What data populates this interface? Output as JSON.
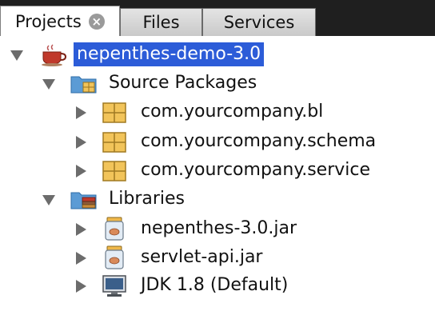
{
  "tabs": [
    {
      "label": "Projects",
      "active": true,
      "close_glyph": "×"
    },
    {
      "label": "Files",
      "active": false
    },
    {
      "label": "Services",
      "active": false
    }
  ],
  "tree": {
    "project": {
      "label": "nepenthes-demo-3.0",
      "icon": "coffee-cup-project-icon",
      "expanded": true,
      "selected": true
    },
    "source_packages": {
      "label": "Source Packages",
      "icon": "source-folder-icon",
      "expanded": true,
      "items": [
        {
          "label": "com.yourcompany.bl",
          "icon": "package-icon",
          "expanded": false
        },
        {
          "label": "com.yourcompany.schema",
          "icon": "package-icon",
          "expanded": false
        },
        {
          "label": "com.yourcompany.service",
          "icon": "package-icon",
          "expanded": false
        }
      ]
    },
    "libraries": {
      "label": "Libraries",
      "icon": "libraries-folder-icon",
      "expanded": true,
      "items": [
        {
          "label": "nepenthes-3.0.jar",
          "icon": "jar-icon",
          "expanded": false
        },
        {
          "label": "servlet-api.jar",
          "icon": "jar-icon",
          "expanded": false
        },
        {
          "label": "JDK 1.8 (Default)",
          "icon": "jdk-monitor-icon",
          "expanded": false
        }
      ]
    }
  },
  "colors": {
    "selection": "#2c5cd8",
    "tab_bar": "#1f1f1f",
    "package_yellow": "#e8b44a"
  }
}
